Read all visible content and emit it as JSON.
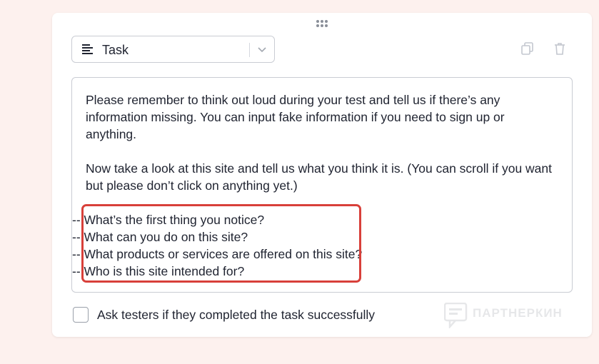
{
  "block_type": {
    "label": "Task",
    "icon": "text-align-left-icon"
  },
  "actions": {
    "duplicate_icon": "copy-icon",
    "delete_icon": "trash-icon"
  },
  "editor": {
    "paragraph1": "Please remember to think out loud during your test and tell us if there’s any information missing. You can input fake information if you need to sign up or anything.",
    "paragraph2": "Now take a look at this site and tell us what you think it is. (You can scroll if you want but please don’t click on anything yet.)",
    "questions": [
      "-- What’s the first thing you notice?",
      "-- What can you do on this site?",
      "-- What products or services are offered on this site?",
      "-- Who is this site intended for?"
    ]
  },
  "completion_checkbox": {
    "label": "Ask testers if they completed the task successfully",
    "checked": false
  },
  "watermark": {
    "text": "ПАРТНЕРКИН"
  },
  "colors": {
    "background": "#fdf1ee",
    "highlight": "#d8403a",
    "text": "#1f2330"
  }
}
